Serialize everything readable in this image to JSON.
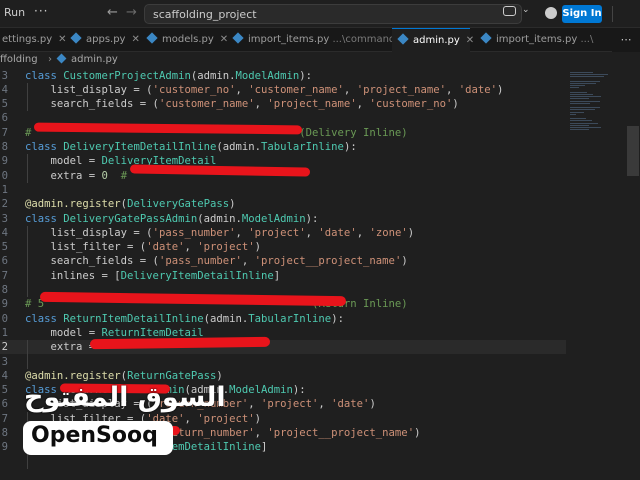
{
  "titlebar": {
    "menu_run": "Run",
    "menu_more": "···",
    "back_icon": "←",
    "forward_icon": "→",
    "command_center": "scaffolding_project",
    "copilot_chevron": "⌄",
    "signin_label": "Sign In"
  },
  "tabs": [
    {
      "label": "ettings.py",
      "suffix": ""
    },
    {
      "label": "apps.py",
      "suffix": ""
    },
    {
      "label": "models.py",
      "suffix": ""
    },
    {
      "label": "import_items.py",
      "suffix": "...\\commands"
    },
    {
      "label": "admin.py",
      "suffix": ""
    },
    {
      "label": "import_items.py",
      "suffix": "...\\"
    }
  ],
  "tabs_more": "⋯",
  "tab_close": "✕",
  "breadcrumb": {
    "folder": "ffolding",
    "separator": "›",
    "file": "admin.py"
  },
  "editor": {
    "lines": [
      {
        "num": "3",
        "segs": [
          {
            "t": "class ",
            "c": "k"
          },
          {
            "t": "CustomerProjectAdmin",
            "c": "c"
          },
          {
            "t": "(admin.",
            "c": ""
          },
          {
            "t": "ModelAdmin",
            "c": "c"
          },
          {
            "t": "):",
            "c": ""
          }
        ]
      },
      {
        "num": "4",
        "segs": [
          {
            "t": "    list_display = (",
            "c": ""
          },
          {
            "t": "'customer_no'",
            "c": "s"
          },
          {
            "t": ", ",
            "c": ""
          },
          {
            "t": "'customer_name'",
            "c": "s"
          },
          {
            "t": ", ",
            "c": ""
          },
          {
            "t": "'project_name'",
            "c": "s"
          },
          {
            "t": ", ",
            "c": ""
          },
          {
            "t": "'date'",
            "c": "s"
          },
          {
            "t": ")",
            "c": ""
          }
        ]
      },
      {
        "num": "5",
        "segs": [
          {
            "t": "    search_fields = (",
            "c": ""
          },
          {
            "t": "'customer_name'",
            "c": "s"
          },
          {
            "t": ", ",
            "c": ""
          },
          {
            "t": "'project_name'",
            "c": "s"
          },
          {
            "t": ", ",
            "c": ""
          },
          {
            "t": "'customer_no'",
            "c": "s"
          },
          {
            "t": ")",
            "c": ""
          }
        ]
      },
      {
        "num": "6",
        "segs": []
      },
      {
        "num": "7",
        "segs": [
          {
            "t": "#                                          (Delivery Inline)",
            "c": "cm"
          }
        ]
      },
      {
        "num": "8",
        "segs": [
          {
            "t": "class ",
            "c": "k"
          },
          {
            "t": "DeliveryItemDetailInline",
            "c": "c"
          },
          {
            "t": "(admin.",
            "c": ""
          },
          {
            "t": "TabularInline",
            "c": "c"
          },
          {
            "t": "):",
            "c": ""
          }
        ]
      },
      {
        "num": "9",
        "segs": [
          {
            "t": "    model = ",
            "c": ""
          },
          {
            "t": "DeliveryItemDetail",
            "c": "c"
          }
        ]
      },
      {
        "num": "0",
        "segs": [
          {
            "t": "    extra = ",
            "c": ""
          },
          {
            "t": "0",
            "c": "n"
          },
          {
            "t": "  # ",
            "c": "cm"
          }
        ]
      },
      {
        "num": "1",
        "segs": []
      },
      {
        "num": "2",
        "segs": [
          {
            "t": "@admin.register",
            "c": "d"
          },
          {
            "t": "(",
            "c": ""
          },
          {
            "t": "DeliveryGatePass",
            "c": "c"
          },
          {
            "t": ")",
            "c": ""
          }
        ]
      },
      {
        "num": "3",
        "segs": [
          {
            "t": "class ",
            "c": "k"
          },
          {
            "t": "DeliveryGatePassAdmin",
            "c": "c"
          },
          {
            "t": "(admin.",
            "c": ""
          },
          {
            "t": "ModelAdmin",
            "c": "c"
          },
          {
            "t": "):",
            "c": ""
          }
        ]
      },
      {
        "num": "4",
        "segs": [
          {
            "t": "    list_display = (",
            "c": ""
          },
          {
            "t": "'pass_number'",
            "c": "s"
          },
          {
            "t": ", ",
            "c": ""
          },
          {
            "t": "'project'",
            "c": "s"
          },
          {
            "t": ", ",
            "c": ""
          },
          {
            "t": "'date'",
            "c": "s"
          },
          {
            "t": ", ",
            "c": ""
          },
          {
            "t": "'zone'",
            "c": "s"
          },
          {
            "t": ")",
            "c": ""
          }
        ]
      },
      {
        "num": "5",
        "segs": [
          {
            "t": "    list_filter = (",
            "c": ""
          },
          {
            "t": "'date'",
            "c": "s"
          },
          {
            "t": ", ",
            "c": ""
          },
          {
            "t": "'project'",
            "c": "s"
          },
          {
            "t": ")",
            "c": ""
          }
        ]
      },
      {
        "num": "6",
        "segs": [
          {
            "t": "    search_fields = (",
            "c": ""
          },
          {
            "t": "'pass_number'",
            "c": "s"
          },
          {
            "t": ", ",
            "c": ""
          },
          {
            "t": "'project__project_name'",
            "c": "s"
          },
          {
            "t": ")",
            "c": ""
          }
        ]
      },
      {
        "num": "7",
        "segs": [
          {
            "t": "    inlines = [",
            "c": ""
          },
          {
            "t": "DeliveryItemDetailInline",
            "c": "c"
          },
          {
            "t": "]",
            "c": ""
          }
        ]
      },
      {
        "num": "8",
        "segs": []
      },
      {
        "num": "9",
        "segs": [
          {
            "t": "# 5                                          (Return Inline)",
            "c": "cm"
          }
        ]
      },
      {
        "num": "0",
        "segs": [
          {
            "t": "class ",
            "c": "k"
          },
          {
            "t": "ReturnItemDetailInline",
            "c": "c"
          },
          {
            "t": "(admin.",
            "c": ""
          },
          {
            "t": "TabularInline",
            "c": "c"
          },
          {
            "t": "):",
            "c": ""
          }
        ]
      },
      {
        "num": "1",
        "segs": [
          {
            "t": "    model = ",
            "c": ""
          },
          {
            "t": "ReturnItemDetail",
            "c": "c"
          }
        ]
      },
      {
        "num": "2",
        "segs": [
          {
            "t": "    extra = ",
            "c": ""
          }
        ],
        "current": true
      },
      {
        "num": "3",
        "segs": []
      },
      {
        "num": "4",
        "segs": [
          {
            "t": "@admin.register",
            "c": "d"
          },
          {
            "t": "(",
            "c": ""
          },
          {
            "t": "ReturnGatePass",
            "c": "c"
          },
          {
            "t": ")",
            "c": ""
          }
        ]
      },
      {
        "num": "5",
        "segs": [
          {
            "t": "class ",
            "c": "k"
          },
          {
            "t": "ReturnGatePassAdmin",
            "c": "c"
          },
          {
            "t": "(admin.",
            "c": ""
          },
          {
            "t": "ModelAdmin",
            "c": "c"
          },
          {
            "t": "):",
            "c": ""
          }
        ]
      },
      {
        "num": "6",
        "segs": [
          {
            "t": "    list_display = (",
            "c": ""
          },
          {
            "t": "'return_number'",
            "c": "s"
          },
          {
            "t": ", ",
            "c": ""
          },
          {
            "t": "'project'",
            "c": "s"
          },
          {
            "t": ", ",
            "c": ""
          },
          {
            "t": "'date'",
            "c": "s"
          },
          {
            "t": ")",
            "c": ""
          }
        ]
      },
      {
        "num": "7",
        "segs": [
          {
            "t": "    list_filter = (",
            "c": ""
          },
          {
            "t": "'date'",
            "c": "s"
          },
          {
            "t": ", ",
            "c": ""
          },
          {
            "t": "'project'",
            "c": "s"
          },
          {
            "t": ")",
            "c": ""
          }
        ]
      },
      {
        "num": "8",
        "segs": [
          {
            "t": "    search_fields = (",
            "c": ""
          },
          {
            "t": "'return_number'",
            "c": "s"
          },
          {
            "t": ", ",
            "c": ""
          },
          {
            "t": "'project__project_name'",
            "c": "s"
          },
          {
            "t": ")",
            "c": ""
          }
        ]
      },
      {
        "num": "9",
        "segs": [
          {
            "t": "    inlines = [",
            "c": ""
          },
          {
            "t": "ReturnItemDetailInline",
            "c": "c"
          },
          {
            "t": "]",
            "c": ""
          }
        ]
      }
    ]
  },
  "watermark": {
    "arabic": "السوق المفتوح",
    "brand": "OpenSooq"
  }
}
